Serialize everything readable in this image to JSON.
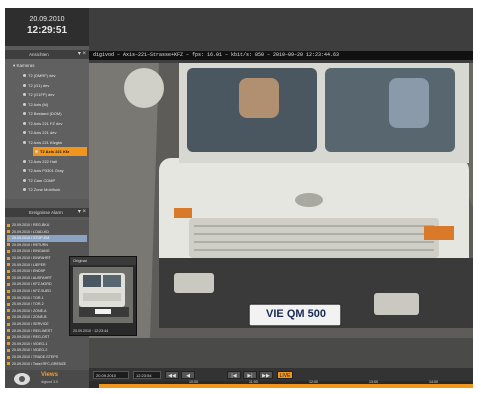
{
  "clock": {
    "date": "20.09.2010",
    "time": "12:29:51"
  },
  "tree": {
    "header": "Ansichten",
    "root_label": "Kameras",
    "nodes": [
      "T2 (DMRF) dev",
      "T2 (G1) dev",
      "T2 (G1FP) dev",
      "T2 Axis (M)",
      "T2 Bestand (DOM)",
      "T2 Axis 221 FZ dev",
      "T2 Axis 221 dev",
      "T2 Axis 221 Kfzgtw",
      "T2 Axis 221 Kfz",
      "T2 Axis 222 Hall",
      "T2 Axis P3301 Gray",
      "T2 Cam CDMP",
      "T2 Zone Mobifunk"
    ],
    "selected_index": 8
  },
  "events": {
    "header": "Ereignisse Alarm",
    "rows": [
      "20.09.2010 / REG-BKU",
      "20.09.2010 / LOAD-KD",
      "20.09.2010 / STOP-EM",
      "20.09.2010 / RETURN",
      "20.09.2010 / EINGANG",
      "20.09.2010 / EINFAHRT",
      "20.09.2010 / LIEFER",
      "20.09.2010 / ENDSP",
      "20.09.2010 / AUSFAHRT",
      "20.09.2010 / KFZ-NORD",
      "20.09.2010 / KFZ-SUED",
      "20.09.2010 / TOR-1",
      "20.09.2010 / TOR-2",
      "20.09.2010 / ZONE-A",
      "20.09.2010 / ZONE-B",
      "20.09.2010 / SERVICE",
      "20.09.2010 / REG-WEST",
      "20.09.2010 / REG-OST",
      "20.09.2010 / VIDEO-1",
      "20.09.2010 / VIDEO-2",
      "20.09.2010 / TRADE-STEPS",
      "20.09.2010 / Tabel RFC-GRENZE"
    ],
    "highlight_index": 2
  },
  "video": {
    "info": "digivod – Axis–221–Strasse+KFZ – fps: 16.01 – kbit/s: 850 – 2010–09–20 12:23:44.63",
    "plate": "VIE QM 500"
  },
  "popup": {
    "title": "Original",
    "footer": "20.09.2010 · 12:23:44"
  },
  "logo": {
    "name": "Views",
    "version": "digivod 3.0"
  },
  "controls": {
    "date": "20.09.2010",
    "time": "12:23:54",
    "btn_prev": "◀◀",
    "btn_back": "◀",
    "btn_step_back": "|◀",
    "btn_step_fwd": "▶|",
    "btn_fwd": "▶▶",
    "btn_live": "LIVE",
    "ticks": [
      "10:00",
      "11:00",
      "12:00",
      "13:00",
      "14:00"
    ]
  },
  "colors": {
    "accent": "#f0961e",
    "chrome": "#3a3a3a"
  }
}
